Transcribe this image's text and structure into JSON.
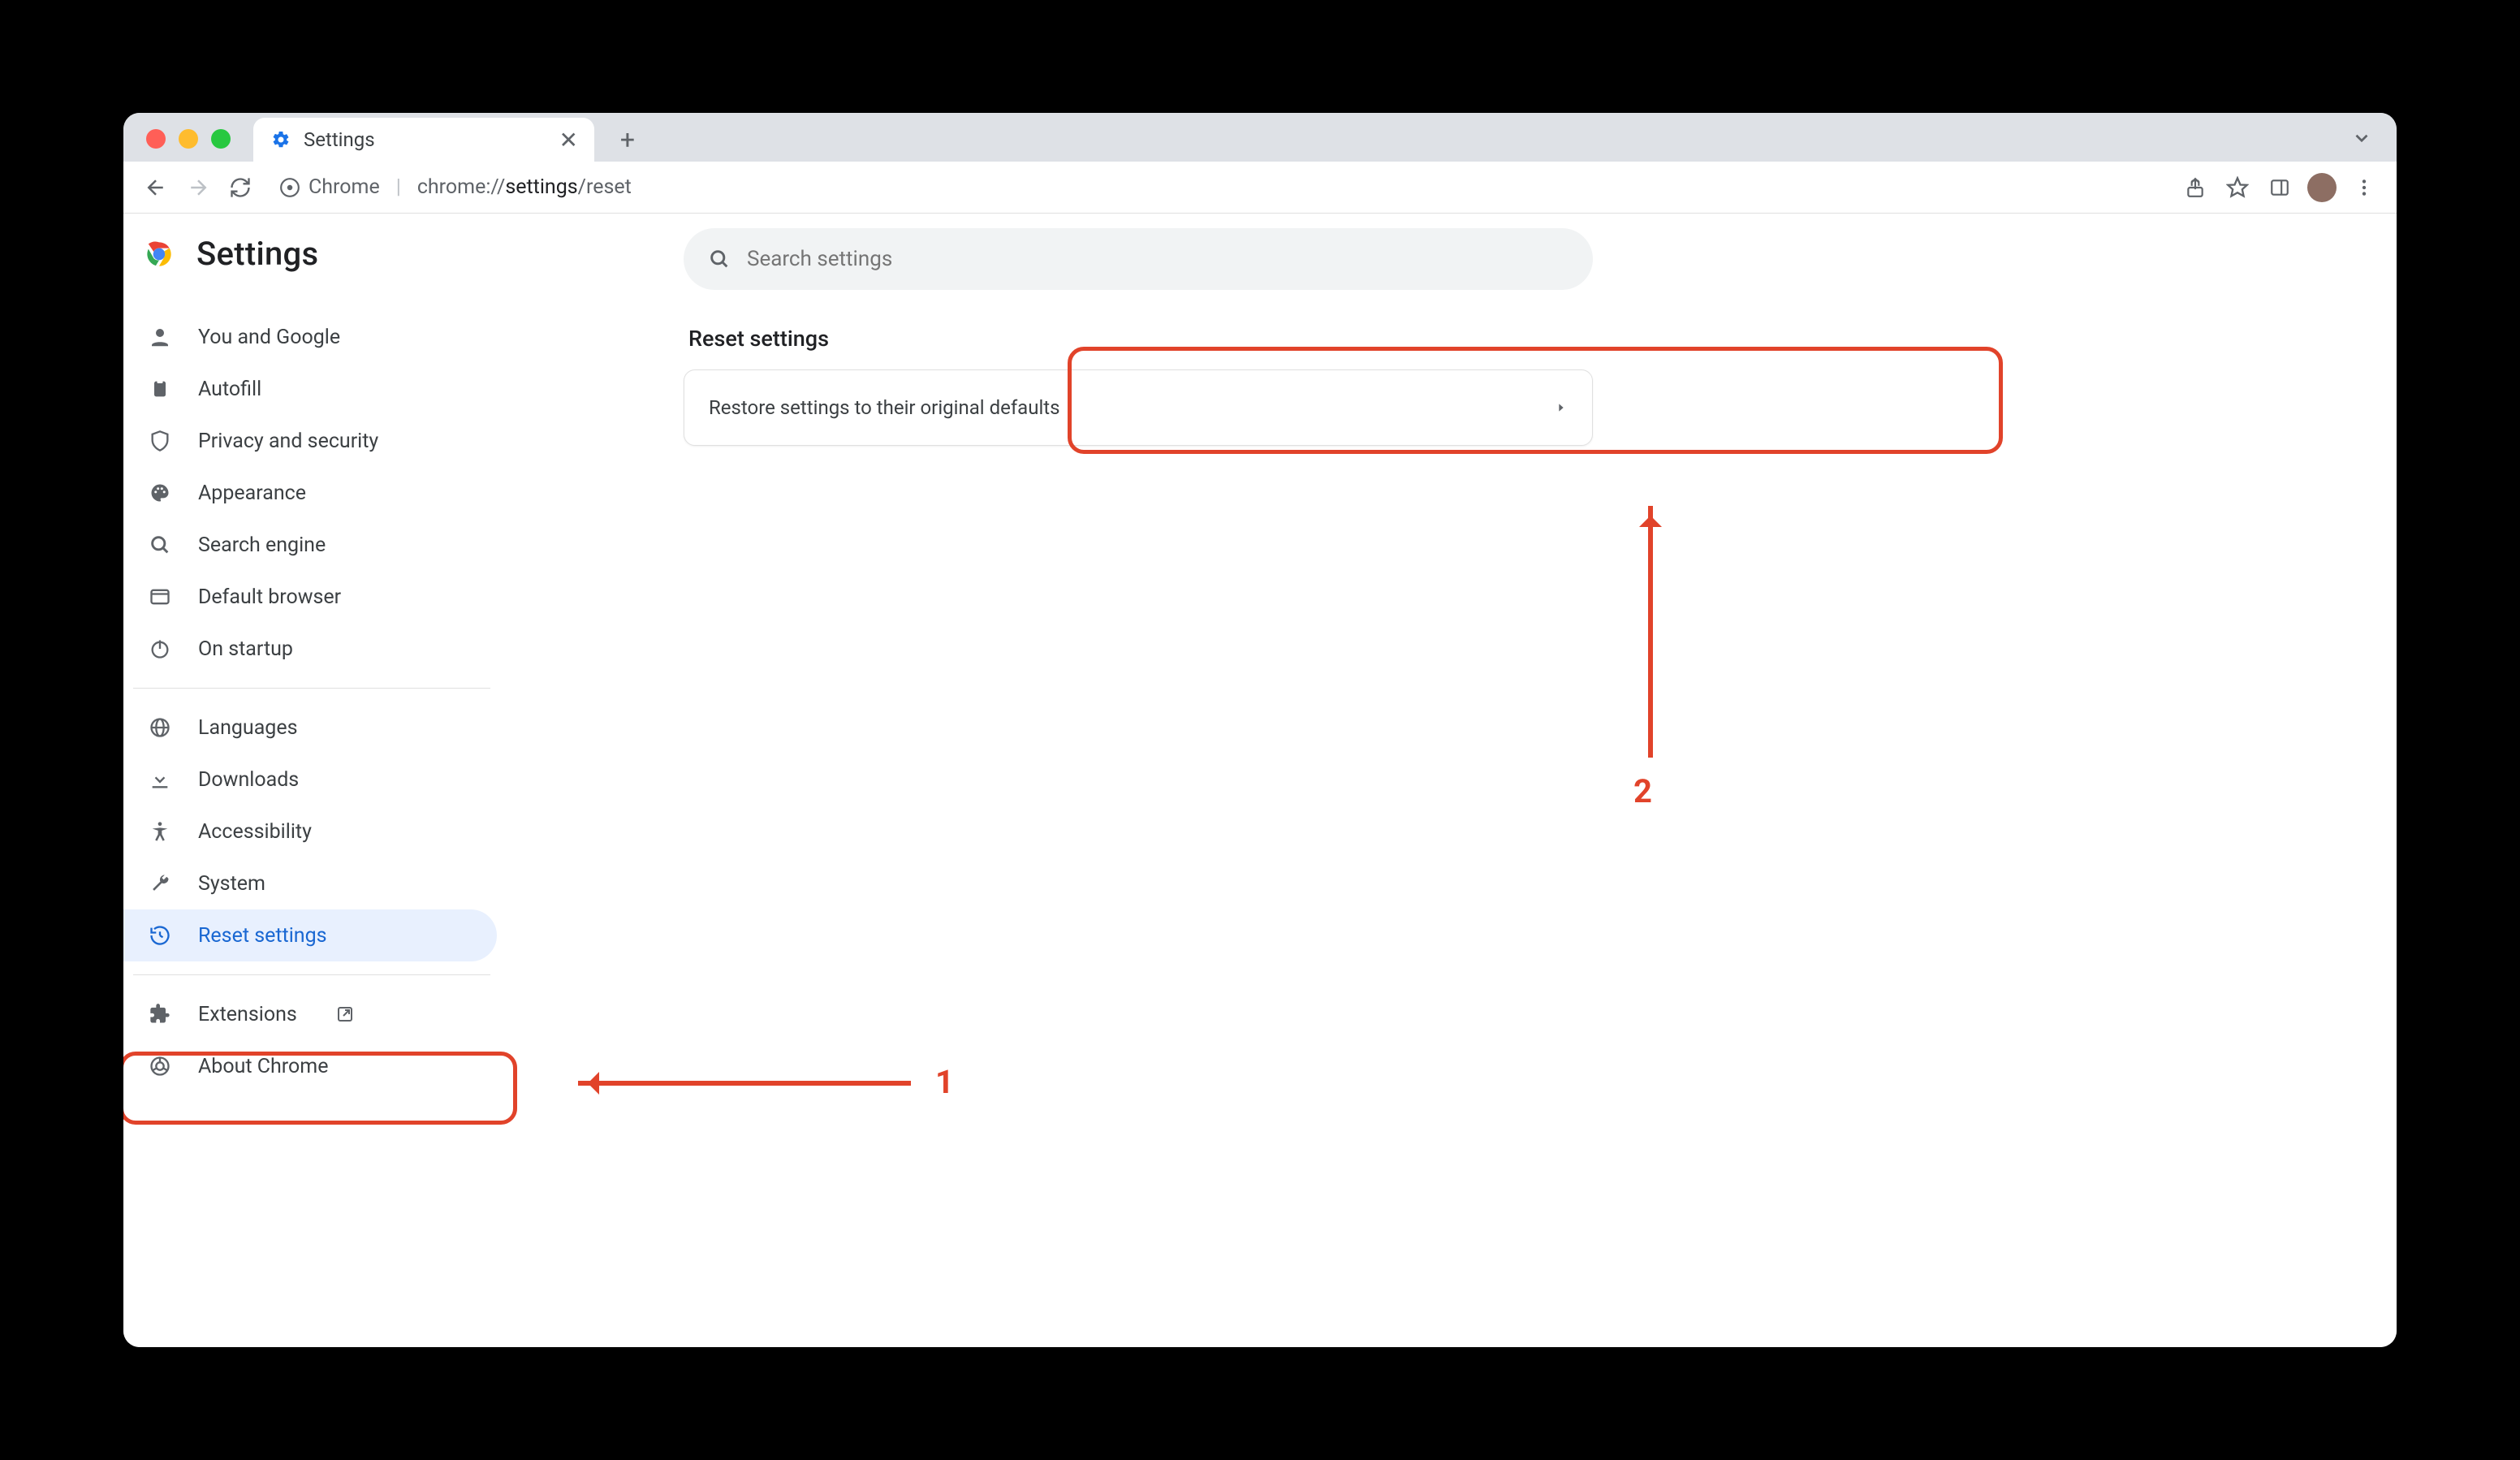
{
  "window": {
    "tab_title": "Settings",
    "url_prefix": "Chrome",
    "url_scheme": "chrome://",
    "url_bold": "settings",
    "url_rest": "/reset"
  },
  "header": {
    "title": "Settings"
  },
  "search": {
    "placeholder": "Search settings"
  },
  "sidebar": {
    "items": [
      {
        "label": "You and Google"
      },
      {
        "label": "Autofill"
      },
      {
        "label": "Privacy and security"
      },
      {
        "label": "Appearance"
      },
      {
        "label": "Search engine"
      },
      {
        "label": "Default browser"
      },
      {
        "label": "On startup"
      },
      {
        "label": "Languages"
      },
      {
        "label": "Downloads"
      },
      {
        "label": "Accessibility"
      },
      {
        "label": "System"
      },
      {
        "label": "Reset settings"
      },
      {
        "label": "Extensions"
      },
      {
        "label": "About Chrome"
      }
    ]
  },
  "main": {
    "section_title": "Reset settings",
    "row_label": "Restore settings to their original defaults"
  },
  "annotations": {
    "label1": "1",
    "label2": "2"
  }
}
